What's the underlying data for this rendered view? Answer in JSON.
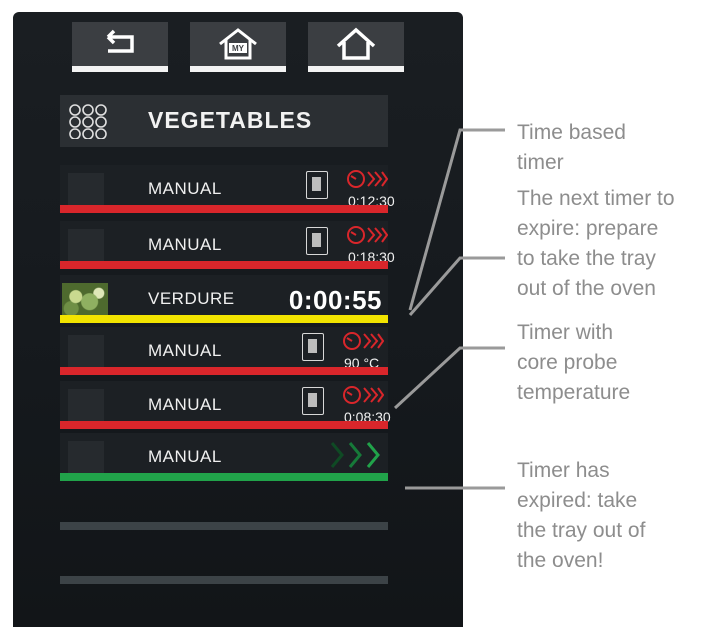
{
  "nav": {
    "back_icon": "back-arrow-icon",
    "my_home_icon": "my-home-icon",
    "my_home_badge": "MY",
    "home_icon": "home-icon"
  },
  "header": {
    "title": "VEGETABLES",
    "icon": "multi-timer-grid-icon"
  },
  "rows": [
    {
      "name": "MANUAL",
      "time": "0:12:30",
      "bar_color": "#d9262b",
      "status": "timer-running"
    },
    {
      "name": "MANUAL",
      "time": "0:18:30",
      "bar_color": "#d9262b",
      "status": "timer-running"
    },
    {
      "name": "VERDURE",
      "time": "0:00:55",
      "bar_color": "#f2e400",
      "status": "next-to-expire"
    },
    {
      "name": "MANUAL",
      "time": "90 °C",
      "bar_color": "#d9262b",
      "status": "core-probe"
    },
    {
      "name": "MANUAL",
      "time": "0:08:30",
      "bar_color": "#d9262b",
      "status": "timer-running"
    },
    {
      "name": "MANUAL",
      "time": "",
      "bar_color": "#21a34a",
      "status": "expired"
    }
  ],
  "callouts": {
    "time_based": "Time based\ntimer",
    "next_timer": "The next timer to\nexpire: prepare\nto take the tray\nout of the oven",
    "core_probe": "Timer with\ncore probe\ntemperature",
    "expired": "Timer has\nexpired: take\nthe tray out of\nthe oven!"
  },
  "colors": {
    "red": "#d9262b",
    "yellow": "#f2e400",
    "green": "#21a34a",
    "callout_text": "#8d8d8d"
  }
}
